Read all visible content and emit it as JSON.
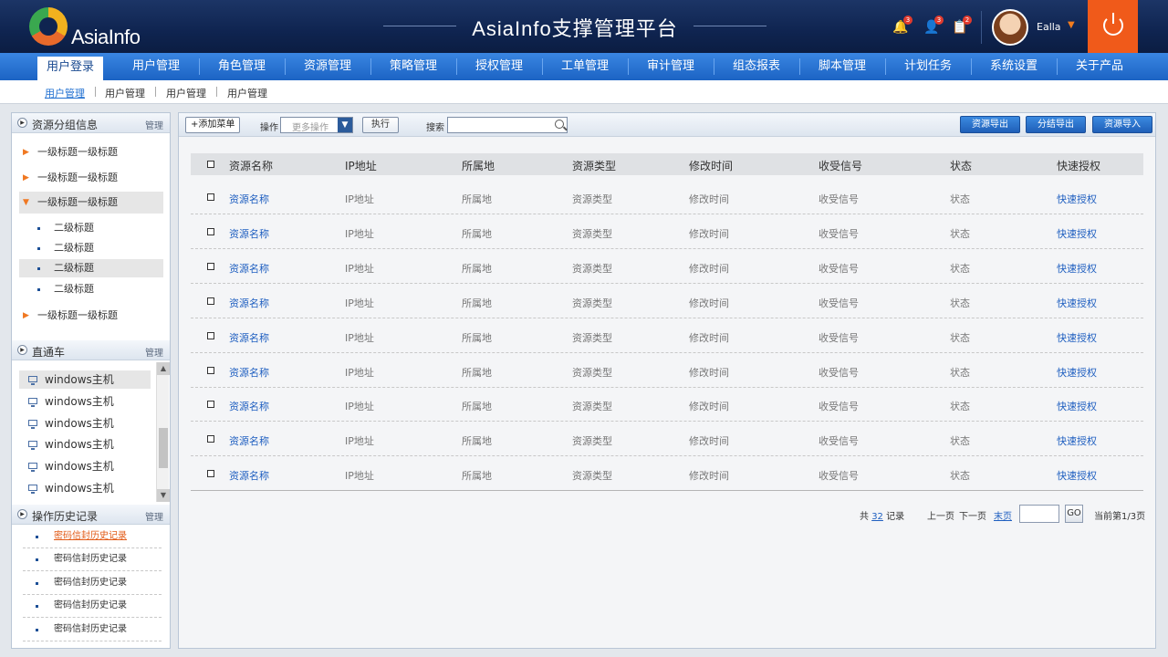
{
  "header": {
    "logo_text": "AsiaInfo",
    "title": "AsiaInfo支撑管理平台",
    "notifications": [
      {
        "icon": "bell-icon",
        "count": "3"
      },
      {
        "icon": "user-icon",
        "count": "3"
      },
      {
        "icon": "document-icon",
        "count": "2"
      }
    ],
    "user_name": "Ealla",
    "accent": "#f05a1a"
  },
  "nav": {
    "items": [
      "用户登录",
      "用户管理",
      "角色管理",
      "资源管理",
      "策略管理",
      "授权管理",
      "工单管理",
      "审计管理",
      "组态报表",
      "脚本管理",
      "计划任务",
      "系统设置",
      "关于产品"
    ],
    "active_index": 0
  },
  "subnav": {
    "items": [
      "用户管理",
      "用户管理",
      "用户管理",
      "用户管理"
    ]
  },
  "sidebar": {
    "groups_panel": {
      "title": "资源分组信息",
      "manage": "管理",
      "items": [
        "一级标题一级标题",
        "一级标题一级标题",
        "一级标题一级标题",
        "一级标题一级标题"
      ],
      "sub_items": [
        "二级标题",
        "二级标题",
        "二级标题",
        "二级标题"
      ]
    },
    "direct_panel": {
      "title": "直通车",
      "manage": "管理",
      "hosts": [
        "windows主机",
        "windows主机",
        "windows主机",
        "windows主机",
        "windows主机",
        "windows主机"
      ]
    },
    "history_panel": {
      "title": "操作历史记录",
      "manage": "管理",
      "items": [
        "密码信封历史记录",
        "密码信封历史记录",
        "密码信封历史记录",
        "密码信封历史记录",
        "密码信封历史记录"
      ]
    }
  },
  "toolbar": {
    "add_label": "+添加菜单",
    "op_label": "操作",
    "select_value": "更多操作",
    "exec_label": "执行",
    "search_label": "搜索",
    "search_value": "",
    "export_resources": "资源导出",
    "export_split": "分结导出",
    "import_resources": "资源导入"
  },
  "table": {
    "columns": [
      "资源名称",
      "IP地址",
      "所属地",
      "资源类型",
      "修改时间",
      "收受信号",
      "状态",
      "快速授权"
    ],
    "rows": [
      [
        "资源名称",
        "IP地址",
        "所属地",
        "资源类型",
        "修改时间",
        "收受信号",
        "状态",
        "快速授权"
      ],
      [
        "资源名称",
        "IP地址",
        "所属地",
        "资源类型",
        "修改时间",
        "收受信号",
        "状态",
        "快速授权"
      ],
      [
        "资源名称",
        "IP地址",
        "所属地",
        "资源类型",
        "修改时间",
        "收受信号",
        "状态",
        "快速授权"
      ],
      [
        "资源名称",
        "IP地址",
        "所属地",
        "资源类型",
        "修改时间",
        "收受信号",
        "状态",
        "快速授权"
      ],
      [
        "资源名称",
        "IP地址",
        "所属地",
        "资源类型",
        "修改时间",
        "收受信号",
        "状态",
        "快速授权"
      ],
      [
        "资源名称",
        "IP地址",
        "所属地",
        "资源类型",
        "修改时间",
        "收受信号",
        "状态",
        "快速授权"
      ],
      [
        "资源名称",
        "IP地址",
        "所属地",
        "资源类型",
        "修改时间",
        "收受信号",
        "状态",
        "快速授权"
      ],
      [
        "资源名称",
        "IP地址",
        "所属地",
        "资源类型",
        "修改时间",
        "收受信号",
        "状态",
        "快速授权"
      ],
      [
        "资源名称",
        "IP地址",
        "所属地",
        "资源类型",
        "修改时间",
        "收受信号",
        "状态",
        "快速授权"
      ]
    ]
  },
  "pager": {
    "total_prefix": "共",
    "total": "32",
    "total_suffix": "记录",
    "prev": "上一页",
    "next": "下一页",
    "last": "末页",
    "go": "GO",
    "current": "当前第1/3页"
  }
}
